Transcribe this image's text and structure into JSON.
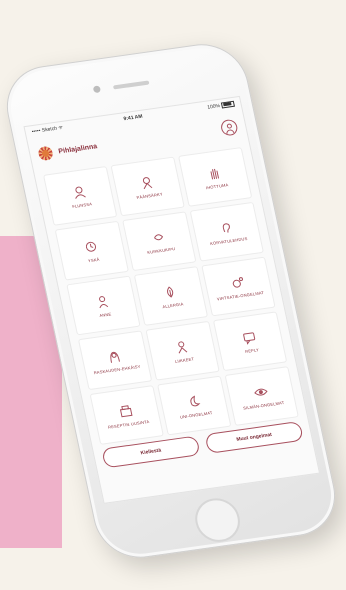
{
  "colors": {
    "accent": "#8a2f3c",
    "icon": "#a8505e",
    "background": "#f6f2ea",
    "pink": "#efb1c9"
  },
  "statusbar": {
    "carrier": "••••• Sketch ᯤ",
    "time": "9:41 AM",
    "battery": "100%"
  },
  "header": {
    "title": "Pihlajalinna",
    "profile_icon": "user-circle-icon",
    "logo_icon": "pihlajalinna-logo"
  },
  "tiles": [
    {
      "label": "FLUNSSA",
      "icon": "person-cough-icon"
    },
    {
      "label": "PÄÄNSÄRKY",
      "icon": "person-head-icon"
    },
    {
      "label": "IHOTTUMA",
      "icon": "hand-icon"
    },
    {
      "label": "YSKÄ",
      "icon": "cough-icon"
    },
    {
      "label": "KURKKUKIPU",
      "icon": "throat-icon"
    },
    {
      "label": "KORVATULEHDUS",
      "icon": "ear-icon"
    },
    {
      "label": "ANNE",
      "icon": "person-icon"
    },
    {
      "label": "ALLERGIA",
      "icon": "leaf-icon"
    },
    {
      "label": "VIRTSATIE-ONGELMAT",
      "icon": "bladder-icon"
    },
    {
      "label": "RASKAUDEN-EHKÄISY",
      "icon": "woman-icon"
    },
    {
      "label": "LIIKKEET",
      "icon": "person-move-icon"
    },
    {
      "label": "REPLY",
      "icon": "chat-icon"
    },
    {
      "label": "RESEPTIN UUSINTA",
      "icon": "prescription-icon"
    },
    {
      "label": "UNI-ONGELMAT",
      "icon": "moon-icon"
    },
    {
      "label": "SILMÄN-ONGELMAT",
      "icon": "eye-icon"
    }
  ],
  "buttons": {
    "left": "Kiellestä",
    "right": "Muut ongelmat"
  }
}
